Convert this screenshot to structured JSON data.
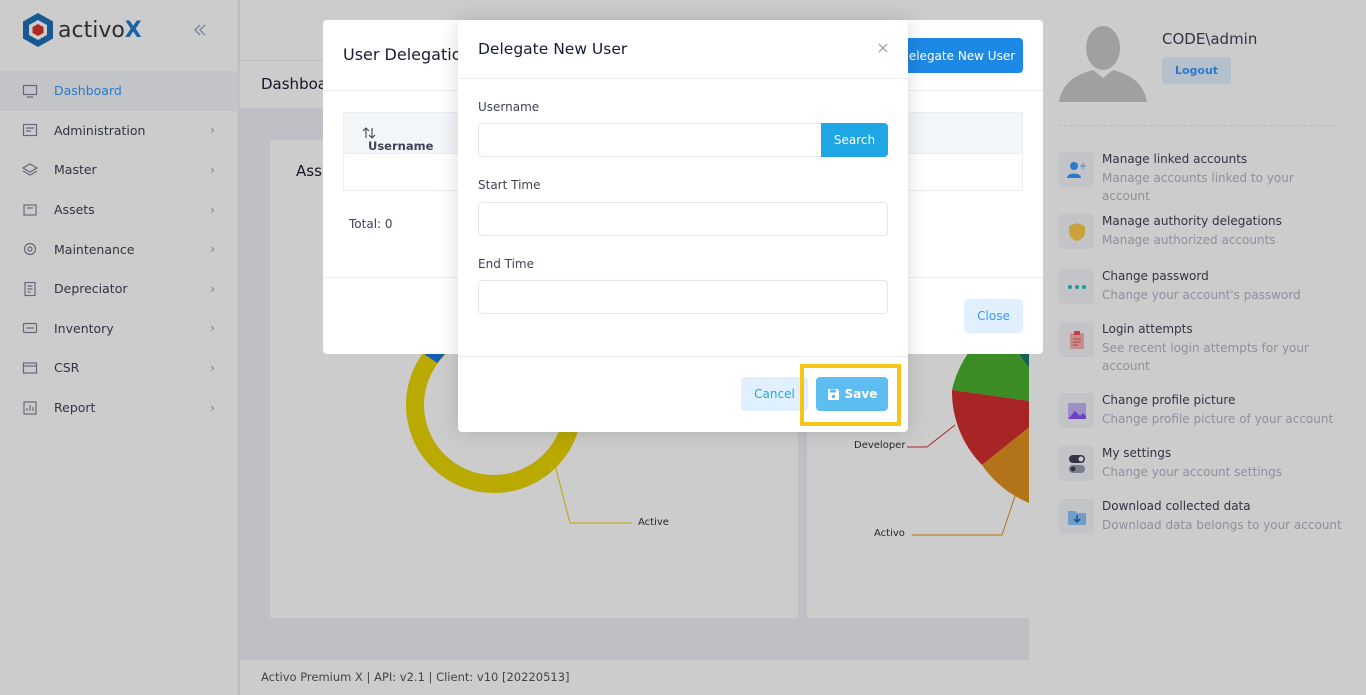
{
  "brand": {
    "name": "activo",
    "accent": "X"
  },
  "sidebar": {
    "items": [
      {
        "label": "Dashboard",
        "icon": "monitor-icon",
        "active": true
      },
      {
        "label": "Administration",
        "icon": "admin-icon"
      },
      {
        "label": "Master",
        "icon": "layers-icon"
      },
      {
        "label": "Assets",
        "icon": "box-icon"
      },
      {
        "label": "Maintenance",
        "icon": "gear-icon"
      },
      {
        "label": "Depreciator",
        "icon": "document-icon"
      },
      {
        "label": "Inventory",
        "icon": "inventory-icon"
      },
      {
        "label": "CSR",
        "icon": "card-icon"
      },
      {
        "label": "Report",
        "icon": "report-icon"
      }
    ]
  },
  "main": {
    "breadcrumb": "Dashboard",
    "card_left_title": "Ass",
    "chart_labels": {
      "active": "Active",
      "developer": "Developer",
      "activo": "Activo"
    },
    "footer": "Activo Premium X | API: v2.1 | Client: v10 [20220513]"
  },
  "user_panel": {
    "username": "CODE\\admin",
    "logout_label": "Logout",
    "items": [
      {
        "title": "Manage linked accounts",
        "subtitle": "Manage accounts linked to your account",
        "icon": "add-user-icon"
      },
      {
        "title": "Manage authority delegations",
        "subtitle": "Manage authorized accounts",
        "icon": "shield-icon"
      },
      {
        "title": "Change password",
        "subtitle": "Change your account's password",
        "icon": "dots-icon"
      },
      {
        "title": "Login attempts",
        "subtitle": "See recent login attempts for your account",
        "icon": "clipboard-icon"
      },
      {
        "title": "Change profile picture",
        "subtitle": "Change profile picture of your account",
        "icon": "image-icon"
      },
      {
        "title": "My settings",
        "subtitle": "Change your account settings",
        "icon": "toggle-icon"
      },
      {
        "title": "Download collected data",
        "subtitle": "Download data belongs to your account",
        "icon": "download-icon"
      }
    ]
  },
  "delegation_modal": {
    "title": "User Delegation",
    "new_button": "elegate New User",
    "column_username": "Username",
    "total": "Total: 0",
    "close_label": "Close"
  },
  "new_user_modal": {
    "title": "Delegate New User",
    "username_label": "Username",
    "username_value": "",
    "search_label": "Search",
    "start_label": "Start Time",
    "start_value": "",
    "end_label": "End Time",
    "end_value": "",
    "cancel_label": "Cancel",
    "save_label": "Save"
  },
  "colors": {
    "primary": "#3699ff",
    "search_button": "#1ea7e4",
    "save_button": "#5ebdf0",
    "highlight": "#f5c518",
    "donut": "#e8d400"
  }
}
